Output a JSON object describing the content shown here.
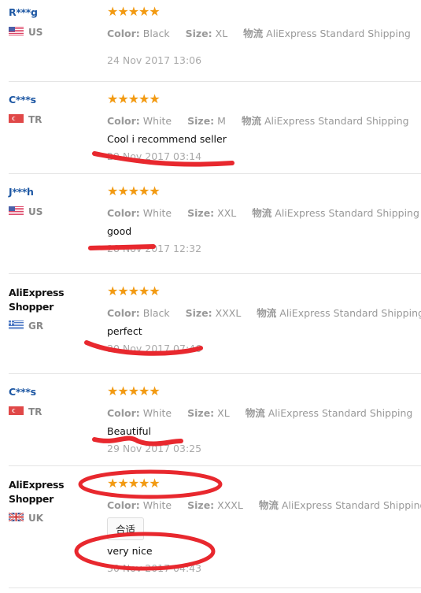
{
  "labels": {
    "color": "Color:",
    "size": "Size:",
    "logistics": "物流"
  },
  "colors": {
    "star": "#f29a12",
    "name": "#1d57a3",
    "annotation": "#e8282e"
  },
  "reviews": [
    {
      "name": "R***g",
      "country": "US",
      "flag": "us-flag-icon",
      "rating": 5,
      "stars": "★★★★★",
      "color": "Black",
      "size": "XL",
      "shipping": "AliExpress Standard Shipping",
      "text": "",
      "date": "24 Nov 2017 13:06"
    },
    {
      "name": "C***s",
      "country": "TR",
      "flag": "tr-flag-icon",
      "rating": 5,
      "stars": "★★★★★",
      "color": "White",
      "size": "M",
      "shipping": "AliExpress Standard Shipping",
      "text": "Cool i recommend seller",
      "date": "29 Nov 2017 03:14"
    },
    {
      "name": "J***h",
      "country": "US",
      "flag": "us-flag-icon",
      "rating": 5,
      "stars": "★★★★★",
      "color": "White",
      "size": "XXL",
      "shipping": "AliExpress Standard Shipping",
      "text": "good",
      "date": "28 Nov 2017 12:32"
    },
    {
      "name": "AliExpress Shopper",
      "country": "GR",
      "flag": "gr-flag-icon",
      "rating": 5,
      "stars": "★★★★★",
      "color": "Black",
      "size": "XXXL",
      "shipping": "AliExpress Standard Shipping",
      "text": "perfect",
      "date": "30 Nov 2017 07:46"
    },
    {
      "name": "C***s",
      "country": "TR",
      "flag": "tr-flag-icon",
      "rating": 5,
      "stars": "★★★★★",
      "color": "White",
      "size": "XL",
      "shipping": "AliExpress Standard Shipping",
      "text": "Beautiful",
      "date": "29 Nov 2017 03:25"
    },
    {
      "name": "AliExpress Shopper",
      "country": "UK",
      "flag": "uk-flag-icon",
      "rating": 5,
      "stars": "★★★★★",
      "color": "White",
      "size": "XXXL",
      "shipping": "AliExpress Standard Shipping",
      "tag": "合适",
      "text": "very nice",
      "date": "30 Nov 2017 04:43"
    }
  ]
}
